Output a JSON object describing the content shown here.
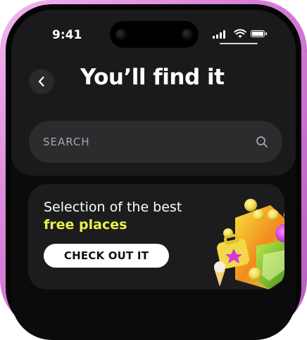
{
  "status_bar": {
    "time": "9:41"
  },
  "header": {
    "title": "You’ll find it"
  },
  "search": {
    "placeholder": "SEARCH"
  },
  "promo": {
    "line1": "Selection of the best",
    "line2": "free places",
    "button_label": "CHECK OUT IT"
  },
  "colors": {
    "frame": "#d77fd6",
    "accent_yellow": "#e8ef4c",
    "card": "#1c1c1e"
  }
}
